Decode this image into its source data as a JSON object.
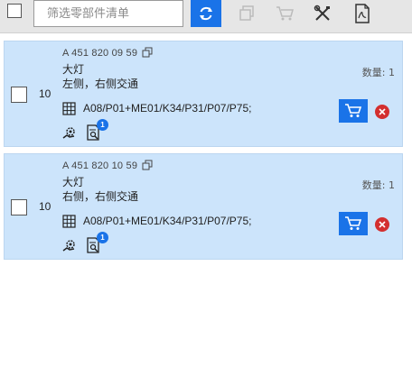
{
  "toolbar": {
    "filter_placeholder": "筛选零部件清单",
    "buttons": [
      {
        "icon": "refresh-icon",
        "enabled": true
      },
      {
        "icon": "copy-icon",
        "enabled": false
      },
      {
        "icon": "cart-icon",
        "enabled": false
      },
      {
        "icon": "tools-crossed-icon",
        "enabled": true
      },
      {
        "icon": "pdf-icon",
        "enabled": true
      }
    ]
  },
  "items": [
    {
      "quantity": "10",
      "part_number": "A 451 820 09 59",
      "name": "大灯",
      "description": "左侧，右侧交通",
      "codes": "A08/P01+ME01/K34/P31/P07/P75;",
      "qty_label": "数量: 1",
      "doc_badge": "1"
    },
    {
      "quantity": "10",
      "part_number": "A 451 820 10 59",
      "name": "大灯",
      "description": "右侧，右侧交通",
      "codes": "A08/P01+ME01/K34/P31/P07/P75;",
      "qty_label": "数量: 1",
      "doc_badge": "1"
    }
  ],
  "colors": {
    "accent": "#1a73e8",
    "card_bg": "#cce4fb",
    "remove": "#d32f2f",
    "toolbar_bg": "#e6e6e6"
  }
}
